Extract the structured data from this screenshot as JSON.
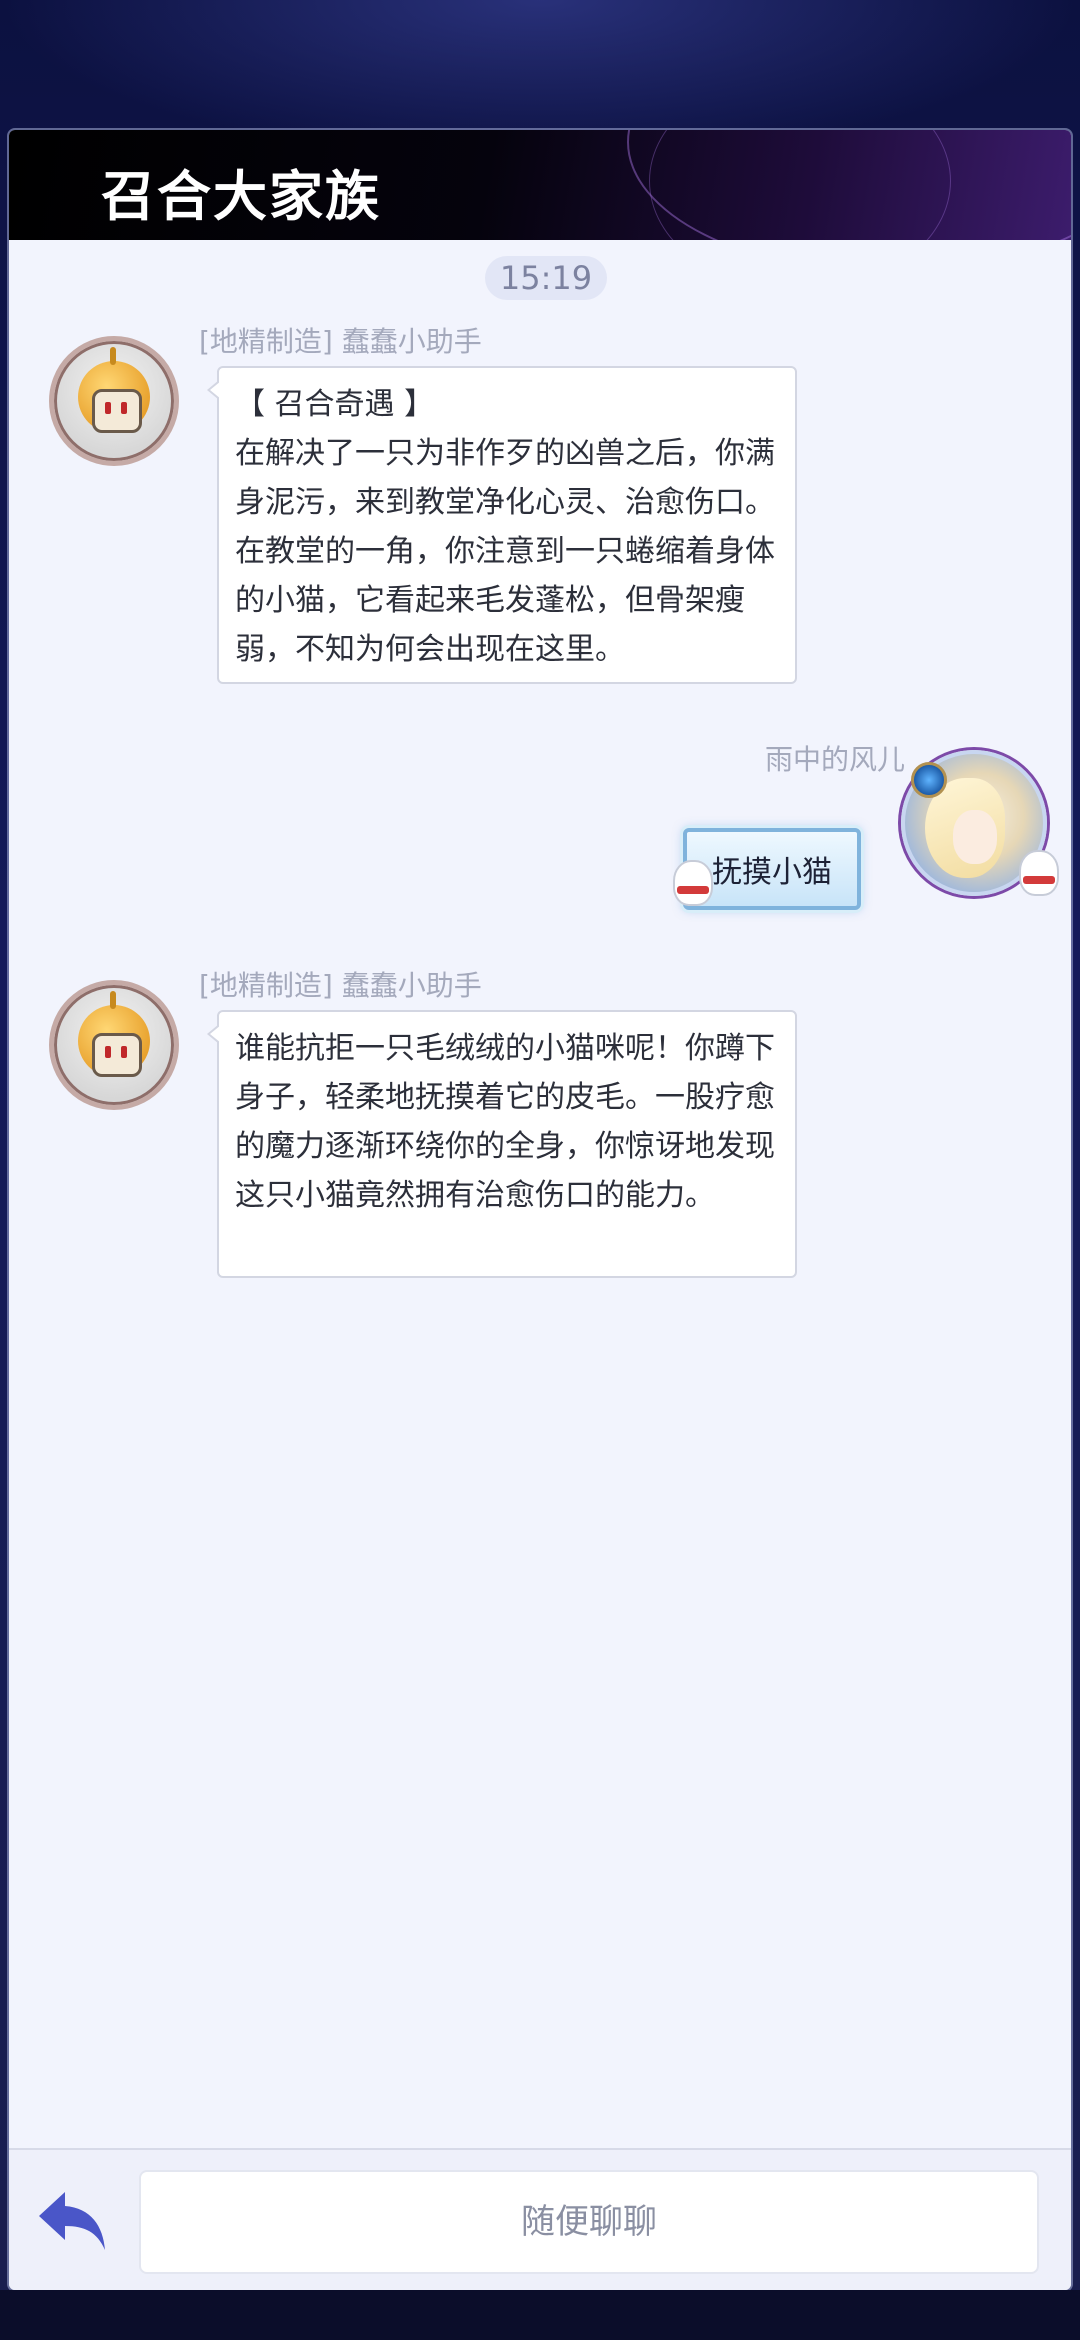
{
  "header": {
    "title": "召合大家族"
  },
  "chat": {
    "timestamp": "15:19",
    "messages": [
      {
        "sender": "[地精制造] 蠢蠢小助手",
        "text": "【 召合奇遇 】\n在解决了一只为非作歹的凶兽之后，你满身泥污，来到教堂净化心灵、治愈伤口。在教堂的一角，你注意到一只蜷缩着身体的小猫，它看起来毛发蓬松，但骨架瘦弱，不知为何会出现在这里。"
      },
      {
        "sender": "雨中的风儿",
        "text": "抚摸小猫"
      },
      {
        "sender": "[地精制造] 蠢蠢小助手",
        "text": "谁能抗拒一只毛绒绒的小猫咪呢！你蹲下身子，轻柔地抚摸着它的皮毛。一股疗愈的魔力逐渐环绕你的全身，你惊讶地发现这只小猫竟然拥有治愈伤口的能力。"
      }
    ]
  },
  "input": {
    "placeholder": "随便聊聊"
  },
  "icons": {
    "reply": "reply-arrow-icon"
  },
  "colors": {
    "accent": "#4a56c8",
    "panel": "#f2f4fd"
  }
}
